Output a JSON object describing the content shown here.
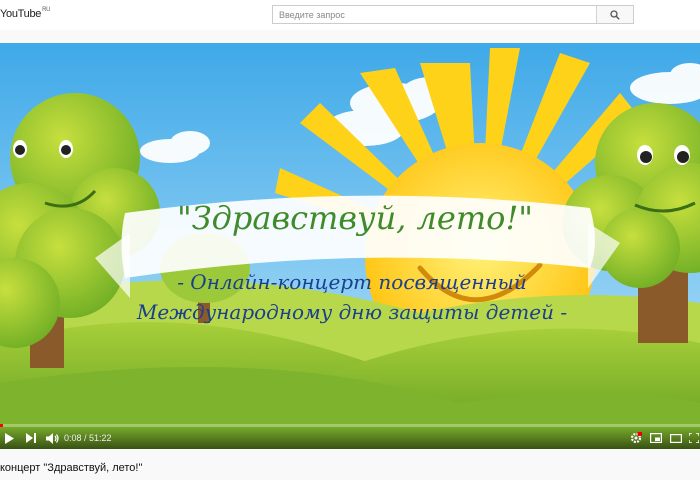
{
  "header": {
    "logo_text": "YouTube",
    "logo_region": "RU",
    "search_placeholder": "Введите запрос",
    "search_icon": "search-icon"
  },
  "video": {
    "banner_title": "\"Здравствуй, лето!\"",
    "subtitle_line1": "- Онлайн-концерт посвященный",
    "subtitle_line2": "Международному дню защиты детей -",
    "colors": {
      "sky": "#6cbff0",
      "sun": "#ffd21a",
      "tree": "#8cc63f",
      "banner_text": "#3f8a2a",
      "subtitle_text": "#1b3f8f"
    }
  },
  "controls": {
    "current_time": "0:08",
    "duration": "51:22",
    "time_display": "0:08 / 51:22",
    "progress_fraction": 0.0026,
    "icons": [
      "play-icon",
      "next-icon",
      "volume-icon",
      "settings-icon",
      "miniplayer-icon",
      "theater-icon",
      "fullscreen-icon"
    ]
  },
  "page_title": "концерт \"Здравствуй, лето!\""
}
